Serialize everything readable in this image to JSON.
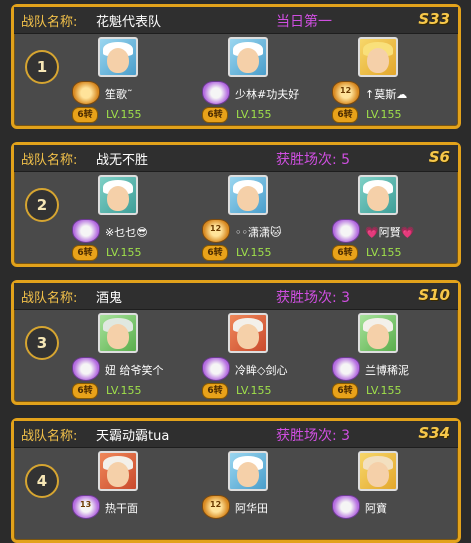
{
  "labels": {
    "team": "战队名称:"
  },
  "teams": [
    {
      "rank": "1",
      "name": "花魁代表队",
      "stat": "当日第一",
      "server": "S33",
      "members": [
        {
          "name": "笙歌˜",
          "turn": "6转",
          "level": "LV.155",
          "badge": ""
        },
        {
          "name": "少林#功夫好",
          "turn": "6转",
          "level": "LV.155",
          "badge": ""
        },
        {
          "name": "↑莫斯☁",
          "turn": "6转",
          "level": "LV.155",
          "badge": "12"
        }
      ]
    },
    {
      "rank": "2",
      "name": "战无不胜",
      "stat": "获胜场次: 5",
      "server": "S6",
      "members": [
        {
          "name": "※乜乜😎",
          "turn": "6转",
          "level": "LV.155",
          "badge": ""
        },
        {
          "name": "◦◦潇潇🐱",
          "turn": "6转",
          "level": "LV.155",
          "badge": "12"
        },
        {
          "name": "💗阿賢💗",
          "turn": "6转",
          "level": "LV.155",
          "badge": ""
        }
      ]
    },
    {
      "rank": "3",
      "name": "酒鬼",
      "stat": "获胜场次: 3",
      "server": "S10",
      "members": [
        {
          "name": "妞 给爷笑个",
          "turn": "6转",
          "level": "LV.155",
          "badge": ""
        },
        {
          "name": "冷眸◇剑心",
          "turn": "6转",
          "level": "LV.155",
          "badge": ""
        },
        {
          "name": "兰博稀泥",
          "turn": "6转",
          "level": "LV.155",
          "badge": ""
        }
      ]
    },
    {
      "rank": "4",
      "name": "天霸动霸tua",
      "stat": "获胜场次: 3",
      "server": "S34",
      "members": [
        {
          "name": "热干面",
          "turn": "",
          "level": "",
          "badge": "13"
        },
        {
          "name": "阿华田",
          "turn": "",
          "level": "",
          "badge": "12"
        },
        {
          "name": "阿寶",
          "turn": "",
          "level": "",
          "badge": ""
        }
      ]
    }
  ]
}
